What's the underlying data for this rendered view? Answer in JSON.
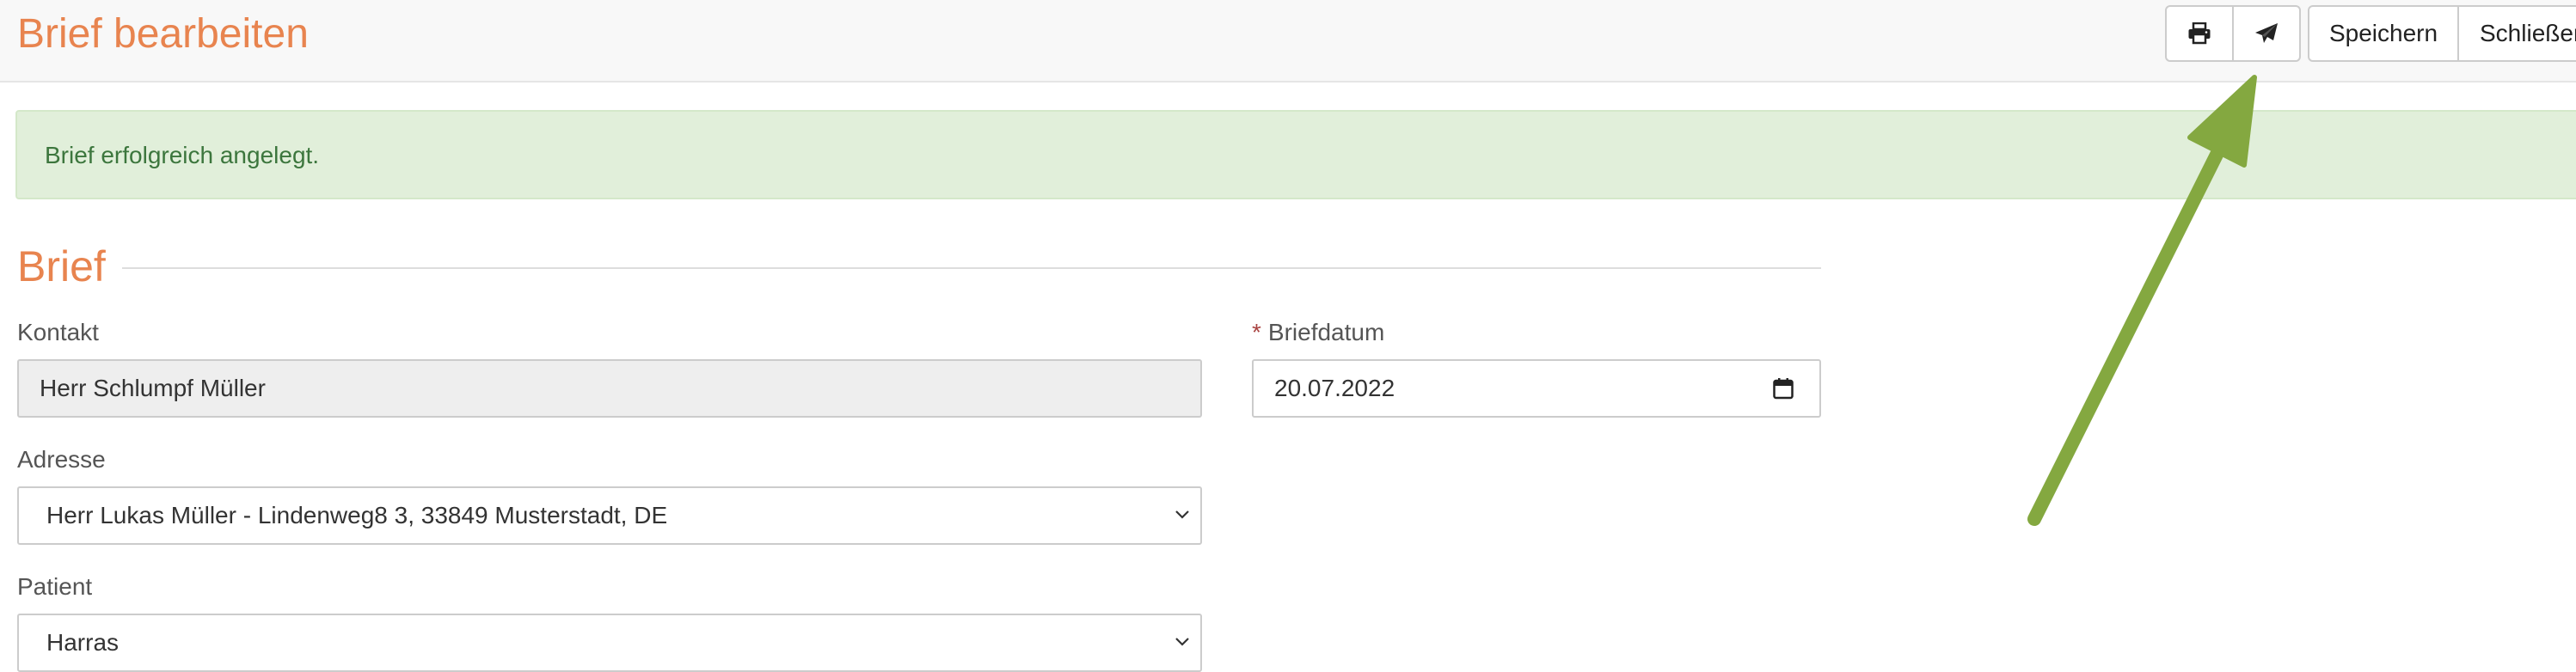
{
  "header": {
    "title": "Brief bearbeiten",
    "toolbar": {
      "print_icon": "print-icon",
      "send_icon": "paper-plane-icon",
      "save_label": "Speichern",
      "close_label": "Schließen"
    }
  },
  "alert": {
    "message": "Brief erfolgreich angelegt.",
    "color": "#3c763d",
    "background": "#e1efda"
  },
  "section": {
    "title": "Brief"
  },
  "form": {
    "contact": {
      "label": "Kontakt",
      "value": "Herr Schlumpf Müller"
    },
    "letter_date": {
      "required_marker": "*",
      "label": "Briefdatum",
      "value": "20.07.2022",
      "icon": "calendar-icon"
    },
    "address": {
      "label": "Adresse",
      "value": "Herr Lukas Müller - Lindenweg8 3, 33849 Musterstadt, DE",
      "icon": "chevron-down-icon"
    },
    "patient": {
      "label": "Patient",
      "value": "Harras",
      "icon": "chevron-down-icon"
    }
  },
  "annotation": {
    "type": "arrow",
    "color": "#84a840",
    "points_to": "send-button"
  },
  "colors": {
    "accent": "#e8844f",
    "header_bg": "#f8f8f8",
    "required": "#a94442"
  }
}
